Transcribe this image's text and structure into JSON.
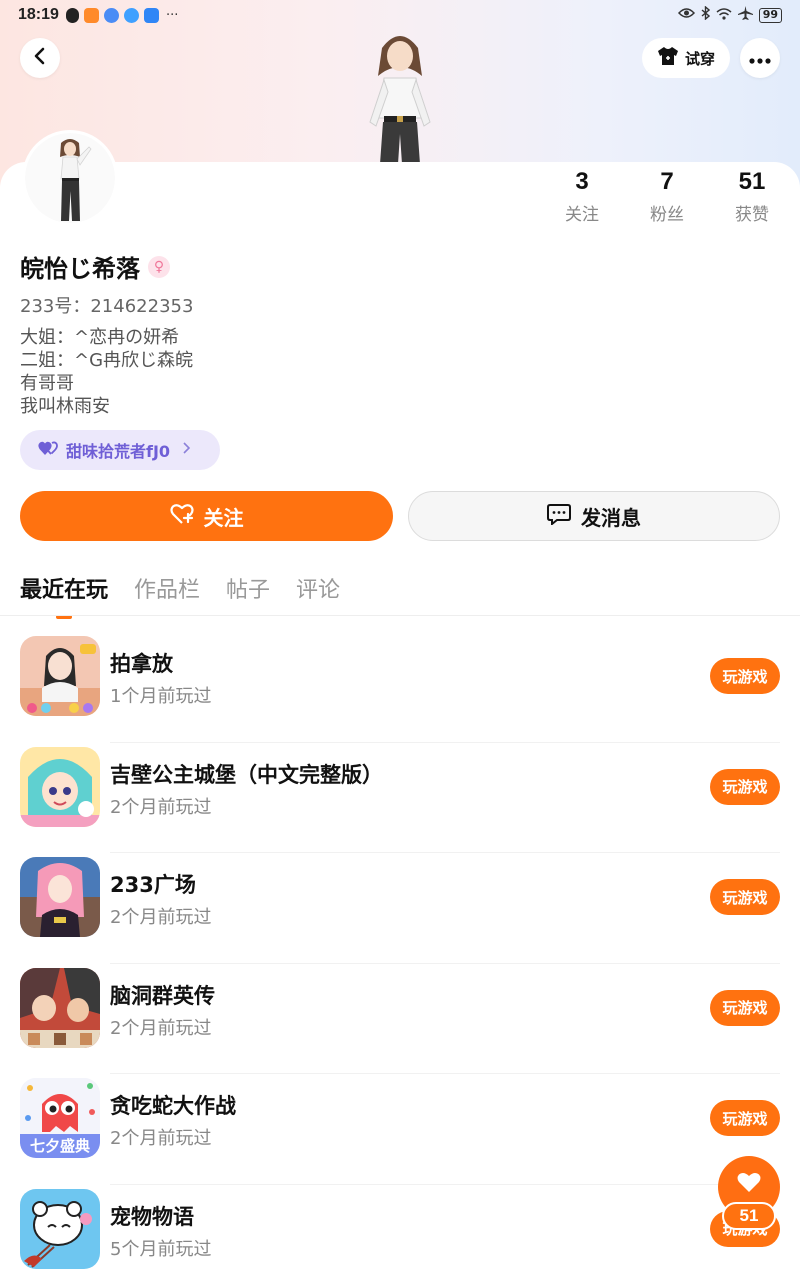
{
  "status_bar": {
    "time": "18:19",
    "overflow": "···",
    "battery": "99"
  },
  "header": {
    "tryon_label": "试穿"
  },
  "stats": [
    {
      "num": "3",
      "label": "关注"
    },
    {
      "num": "7",
      "label": "粉丝"
    },
    {
      "num": "51",
      "label": "获赞"
    }
  ],
  "profile": {
    "name": "皖怡じ希落",
    "gender_symbol": "♀",
    "id_text": "233号：214622353",
    "bio_lines": [
      "大姐：^恋冉の妍希",
      "二姐：^G冉欣じ森皖",
      "有哥哥",
      "我叫林雨安"
    ],
    "guild_label": "甜味拾荒者fJ0"
  },
  "actions": {
    "follow_label": "关注",
    "message_label": "发消息"
  },
  "tabs": [
    "最近在玩",
    "作品栏",
    "帖子",
    "评论"
  ],
  "play_label": "玩游戏",
  "games": [
    {
      "title": "拍拿放",
      "sub": "1个月前玩过"
    },
    {
      "title": "吉壁公主城堡（中文完整版）",
      "sub": "2个月前玩过"
    },
    {
      "title": "233广场",
      "sub": "2个月前玩过"
    },
    {
      "title": "脑洞群英传",
      "sub": "2个月前玩过"
    },
    {
      "title": "贪吃蛇大作战",
      "sub": "2个月前玩过",
      "icon_text": "七夕盛典"
    },
    {
      "title": "宠物物语",
      "sub": "5个月前玩过"
    }
  ],
  "fab": {
    "count": "51"
  },
  "colors": {
    "accent": "#ff7210",
    "guild_bg": "#ece8fb",
    "guild_text": "#6f5fd6"
  }
}
